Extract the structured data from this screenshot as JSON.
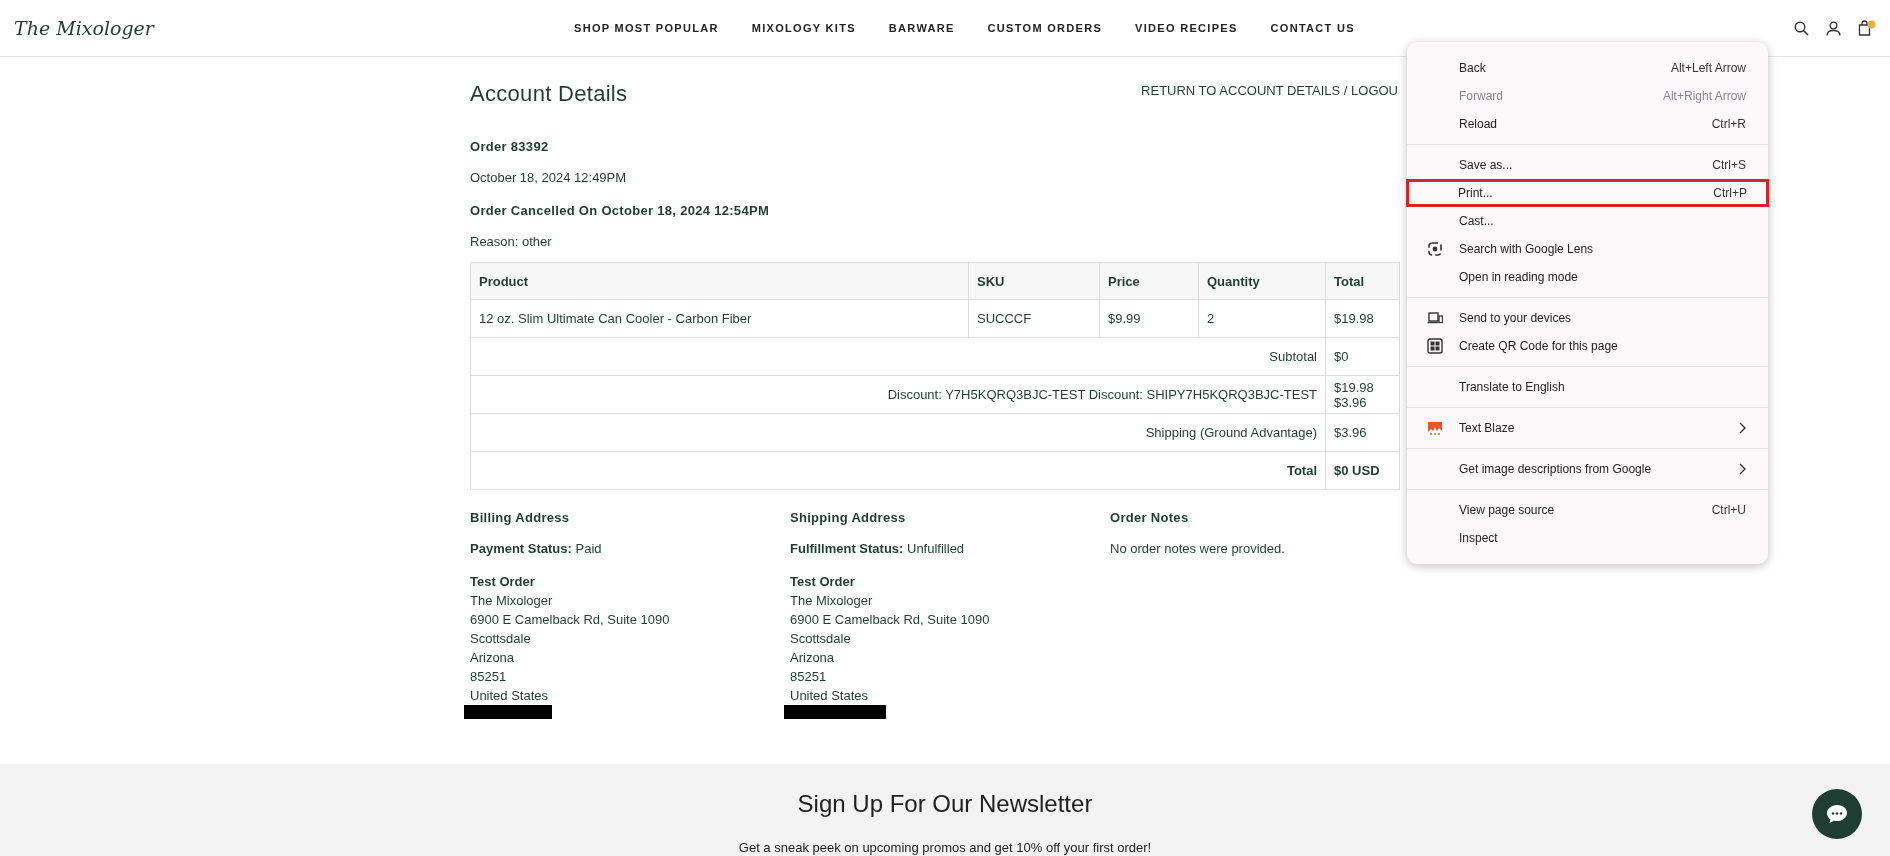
{
  "header": {
    "logo": "The Mixologer",
    "nav": [
      "SHOP MOST POPULAR",
      "MIXOLOGY KITS",
      "BARWARE",
      "CUSTOM ORDERS",
      "VIDEO RECIPES",
      "CONTACT US"
    ]
  },
  "account": {
    "title": "Account Details",
    "links": "RETURN TO ACCOUNT DETAILS / LOGOU",
    "order": "Order 83392",
    "date": "October 18, 2024 12:49PM",
    "cancelled": "Order Cancelled On October 18, 2024 12:54PM",
    "reason": "Reason: other"
  },
  "table": {
    "columns": [
      "Product",
      "SKU",
      "Price",
      "Quantity",
      "Total"
    ],
    "rows": [
      [
        "12 oz. Slim Ultimate Can Cooler - Carbon Fiber",
        "SUCCCF",
        "$9.99",
        "2",
        "$19.98"
      ]
    ],
    "summary": [
      {
        "label": "Subtotal",
        "value": "$0",
        "bold": false
      },
      {
        "label": "Discount: Y7H5KQRQ3BJC-TEST Discount: SHIPY7H5KQRQ3BJC-TEST",
        "value": "$19.98 $3.96",
        "bold": false
      },
      {
        "label": "Shipping (Ground Advantage)",
        "value": "$3.96",
        "bold": false
      },
      {
        "label": "Total",
        "value": "$0 USD",
        "bold": true
      }
    ]
  },
  "addresses": [
    {
      "title": "Billing Address",
      "status": "**Payment Status:** Paid",
      "name": "Test Order",
      "lines": [
        "The Mixologer",
        "6900 E Camelback Rd, Suite 1090",
        "Scottsdale",
        "Arizona",
        "85251",
        "United States"
      ],
      "redacted": true
    },
    {
      "title": "Shipping Address",
      "status": "**Fulfillment Status:** Unfulfilled",
      "name": "Test Order",
      "lines": [
        "The Mixologer",
        "6900 E Camelback Rd, Suite 1090",
        "Scottsdale",
        "Arizona",
        "85251",
        "United States"
      ],
      "redacted": true
    },
    {
      "title": "Order Notes",
      "status": "No order notes were provided."
    }
  ],
  "newsletter": {
    "title": "Sign Up For Our Newsletter",
    "text": "Get a sneak peek on upcoming promos and get 10% off your first order!"
  },
  "context_menu": {
    "groups": [
      {
        "items": [
          {
            "label": "Back",
            "shortcut": "Alt+Left Arrow",
            "disabled": false
          },
          {
            "label": "Forward",
            "shortcut": "Alt+Right Arrow",
            "disabled": true
          },
          {
            "label": "Reload",
            "shortcut": "Ctrl+R",
            "disabled": false
          }
        ]
      },
      {
        "items": [
          {
            "label": "Save as...",
            "shortcut": "Ctrl+S",
            "disabled": false
          },
          {
            "label": "Print...",
            "shortcut": "Ctrl+P",
            "disabled": false,
            "highlighted": true
          },
          {
            "label": "Cast...",
            "disabled": false
          },
          {
            "label": "Search with Google Lens",
            "kind": "lens",
            "disabled": false
          },
          {
            "label": "Open in reading mode",
            "disabled": false
          }
        ]
      },
      {
        "items": [
          {
            "label": "Send to your devices",
            "kind": "devices",
            "disabled": false
          },
          {
            "label": "Create QR Code for this page",
            "kind": "qr",
            "disabled": false
          }
        ]
      },
      {
        "items": [
          {
            "label": "Translate to English",
            "disabled": false
          }
        ]
      },
      {
        "items": [
          {
            "label": "Text Blaze",
            "kind": "blaze",
            "submenu": true,
            "disabled": false
          }
        ]
      },
      {
        "items": [
          {
            "label": "Get image descriptions from Google",
            "submenu": true,
            "disabled": false
          }
        ]
      },
      {
        "items": [
          {
            "label": "View page source",
            "shortcut": "Ctrl+U",
            "disabled": false
          },
          {
            "label": "Inspect",
            "disabled": false
          }
        ]
      }
    ]
  }
}
